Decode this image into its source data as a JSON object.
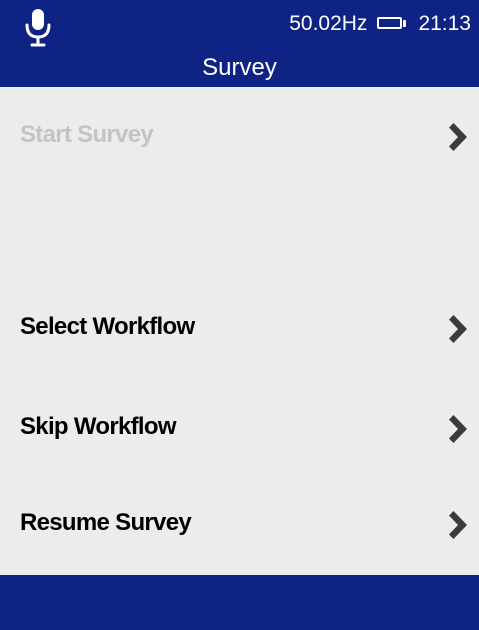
{
  "status_bar": {
    "mic_icon": "microphone-icon",
    "frequency": "50.02Hz",
    "battery_icon": "battery-icon",
    "time": "21:13"
  },
  "header": {
    "title": "Survey"
  },
  "menu": {
    "items": [
      {
        "label": "Start Survey",
        "enabled": false,
        "icon": "chevron-right-icon"
      },
      {
        "label": "Select Workflow",
        "enabled": true,
        "icon": "chevron-right-icon"
      },
      {
        "label": "Skip Workflow",
        "enabled": true,
        "icon": "chevron-right-icon"
      },
      {
        "label": "Resume Survey",
        "enabled": true,
        "icon": "chevron-right-icon"
      }
    ]
  },
  "colors": {
    "header_bg": "#0f2384",
    "content_bg": "#eeeceb",
    "enabled_text": "#000000",
    "disabled_text": "#c4c4c4",
    "chevron": "#3b3b3b"
  }
}
